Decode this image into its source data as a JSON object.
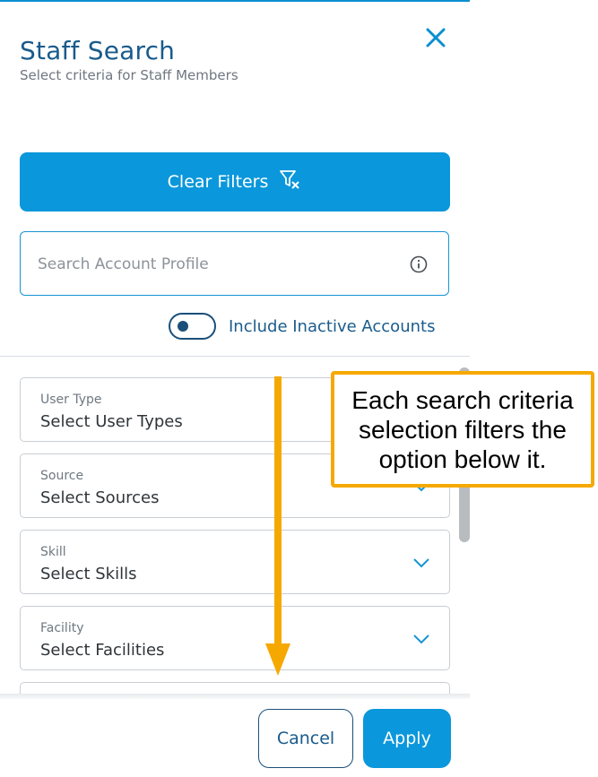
{
  "header": {
    "title": "Staff Search",
    "subtitle": "Select criteria for Staff Members",
    "close_icon": "close-icon"
  },
  "clear_filters": {
    "label": "Clear Filters",
    "icon": "filter-clear-icon"
  },
  "search": {
    "value": "",
    "placeholder": "Search Account Profile",
    "icon": "info-icon"
  },
  "inactive_toggle": {
    "label": "Include Inactive Accounts",
    "on": false
  },
  "filters": [
    {
      "label": "User Type",
      "value": "Select User Types"
    },
    {
      "label": "Source",
      "value": "Select Sources"
    },
    {
      "label": "Skill",
      "value": "Select Skills"
    },
    {
      "label": "Facility",
      "value": "Select Facilities"
    }
  ],
  "footer": {
    "cancel_label": "Cancel",
    "apply_label": "Apply"
  },
  "annotation": {
    "text": "Each search criteria selection filters the option below it."
  },
  "colors": {
    "primary": "#0b97db",
    "title": "#1a5b8c",
    "annotation": "#f5a800"
  }
}
